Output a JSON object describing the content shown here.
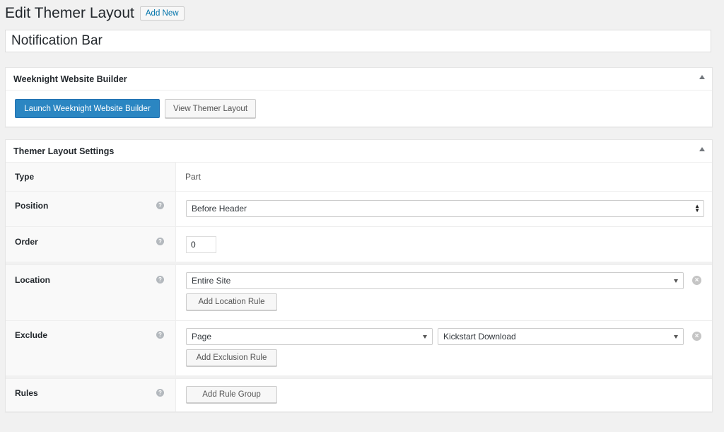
{
  "header": {
    "title": "Edit Themer Layout",
    "add_new_label": "Add New"
  },
  "post_title": "Notification Bar",
  "builder_box": {
    "title": "Weeknight Website Builder",
    "launch_label": "Launch Weeknight Website Builder",
    "view_label": "View Themer Layout"
  },
  "settings_box": {
    "title": "Themer Layout Settings",
    "type": {
      "label": "Type",
      "value": "Part"
    },
    "position": {
      "label": "Position",
      "value": "Before Header"
    },
    "order": {
      "label": "Order",
      "value": "0"
    },
    "location": {
      "label": "Location",
      "value": "Entire Site",
      "add_label": "Add Location Rule"
    },
    "exclude": {
      "label": "Exclude",
      "type_value": "Page",
      "item_value": "Kickstart Download",
      "add_label": "Add Exclusion Rule"
    },
    "rules": {
      "label": "Rules",
      "add_label": "Add Rule Group"
    }
  },
  "icons": {
    "help": "question-circle-icon",
    "remove": "remove-circle-icon",
    "toggle": "triangle-up-icon",
    "select": "chevron-down-icon"
  },
  "colors": {
    "primary": "#2b86c2",
    "link": "#0073aa",
    "background": "#f1f1f1"
  }
}
